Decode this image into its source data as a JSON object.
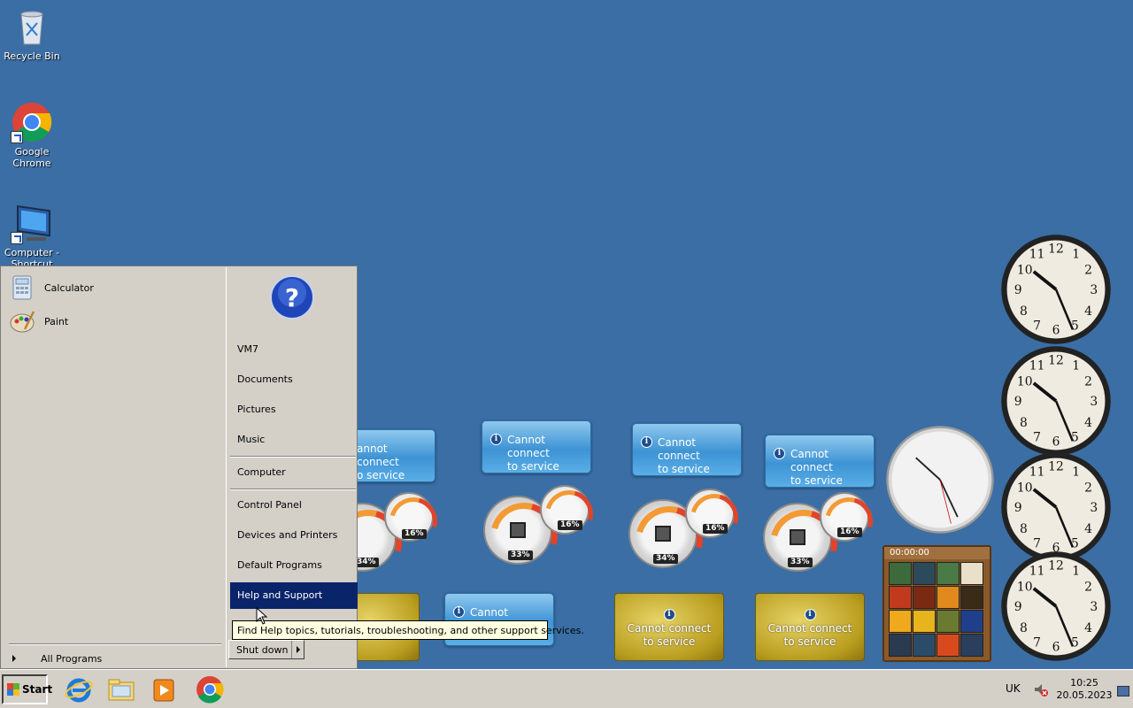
{
  "desktop": {
    "icons": [
      {
        "label": "Recycle Bin"
      },
      {
        "label": "Google\nChrome"
      },
      {
        "label": "Computer -\nShortcut"
      }
    ]
  },
  "gadgets": {
    "weather_text_1": "Cannot connect",
    "weather_text_2": "to service",
    "weather_partial_1": "annot connect",
    "weather_partial_2": "o service",
    "weather_partial_bottom": "Cannot connec",
    "meters": [
      {
        "cpu": "33%",
        "mem": "16%"
      },
      {
        "cpu": "34%",
        "mem": "16%"
      },
      {
        "cpu": "33%",
        "mem": "16%"
      },
      {
        "cpu": "34%",
        "mem": "16%"
      }
    ],
    "puzzle_timer": "00:00:00",
    "colors": {
      "weather": "#3d93d4",
      "currency": "#b99d1e"
    }
  },
  "start_menu": {
    "programs": [
      {
        "label": "Calculator",
        "icon": "calculator-icon"
      },
      {
        "label": "Paint",
        "icon": "paint-icon"
      }
    ],
    "all_programs": "All Programs",
    "right_items": {
      "user": "VM7",
      "documents": "Documents",
      "pictures": "Pictures",
      "music": "Music",
      "computer": "Computer",
      "control_panel": "Control Panel",
      "devices": "Devices and Printers",
      "default_programs": "Default Programs",
      "help": "Help and Support"
    },
    "shutdown": "Shut down",
    "tooltip": "Find Help topics, tutorials, troubleshooting, and other support services."
  },
  "taskbar": {
    "start_label": "Start",
    "language": "UK",
    "time": "10:25",
    "date": "20.05.2023",
    "apps": [
      "internet-explorer-icon",
      "explorer-icon",
      "media-player-icon",
      "chrome-icon"
    ]
  }
}
